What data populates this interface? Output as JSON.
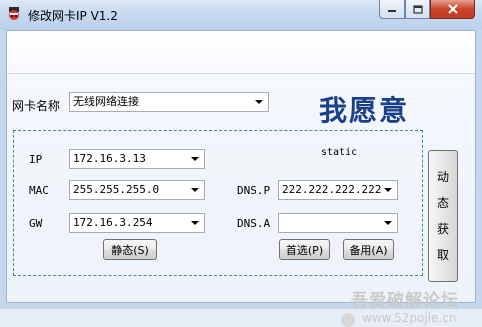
{
  "window": {
    "title": "修改网卡IP V1.2",
    "controls": {
      "minimize_icon": "minimize-icon",
      "maximize_icon": "maximize-icon",
      "close_icon": "close-icon"
    }
  },
  "adapter": {
    "label": "网卡名称",
    "value": "无线网络连接"
  },
  "banner": "我愿意",
  "mode_label": "static",
  "fields": {
    "ip": {
      "label": "IP",
      "value": "172.16.3.13"
    },
    "mac": {
      "label": "MAC",
      "value": "255.255.255.0"
    },
    "gw": {
      "label": "GW",
      "value": "172.16.3.254"
    },
    "dns_p": {
      "label": "DNS.P",
      "value": "222.222.222.222"
    },
    "dns_a": {
      "label": "DNS.A",
      "value": ""
    }
  },
  "buttons": {
    "static": "静态(S)",
    "primary": "首选(P)",
    "backup": "备用(A)",
    "dynamic": [
      "动",
      "态",
      "获",
      "取"
    ]
  },
  "watermark": {
    "text": "吾爱破解论坛",
    "url": "www.52pojie.cn"
  },
  "colors": {
    "banner": "#1c3f8a",
    "group_border": "#3f8f8f",
    "close_button": "#c8452e"
  }
}
